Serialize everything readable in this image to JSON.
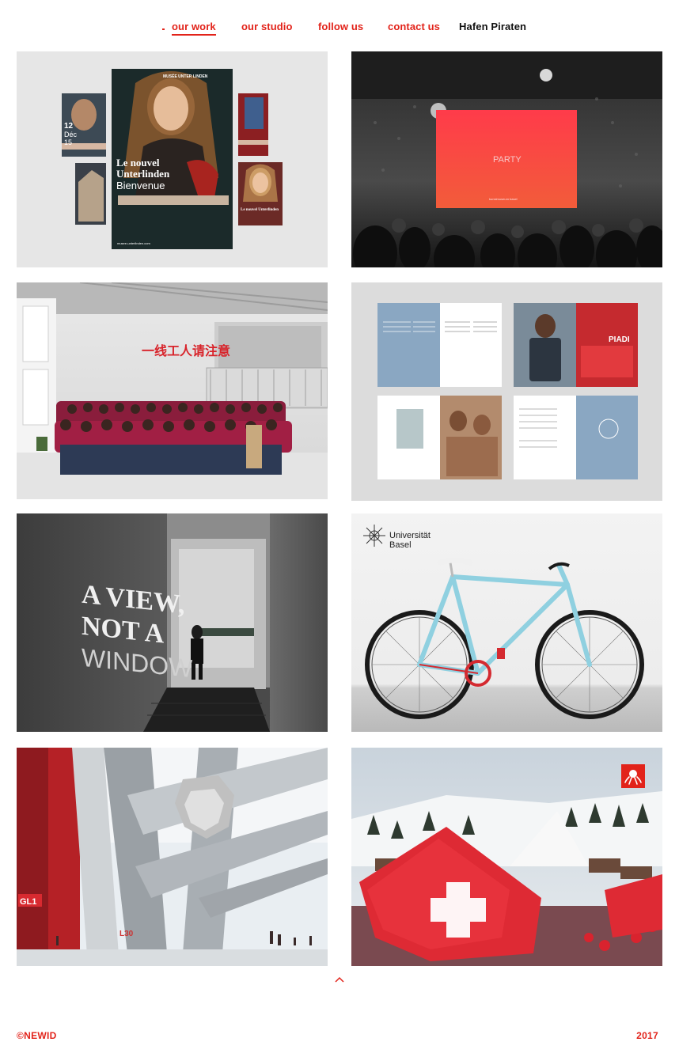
{
  "nav": {
    "items": [
      {
        "label": "our work",
        "active": true
      },
      {
        "label": "our studio",
        "active": false
      },
      {
        "label": "follow us",
        "active": false
      },
      {
        "label": "contact us",
        "active": false
      }
    ],
    "brand": "Hafen Piraten"
  },
  "tiles": {
    "poster": {
      "museum_name": "MUSÉE UNTER LINDEN",
      "headline_1": "Le nouvel",
      "headline_2": "Unterlinden",
      "subline": "Bienvenue",
      "url": "musee-unterlinden.com",
      "small_date_1": "12",
      "small_date_2": "Déc",
      "small_date_3": "15",
      "small_headline": "Le nouvel Unterlinden"
    },
    "party": {
      "screen_text": "PARTY",
      "screen_subtext": "kunstmuseum basel"
    },
    "factory": {
      "banner_text": "一线工人请注意"
    },
    "magazine": {
      "ad_text": "PIADI"
    },
    "view": {
      "wall_line_1": "A VIEW,",
      "wall_line_2": "NOT A",
      "wall_line_3": "WINDOW"
    },
    "bike": {
      "logo_line_1": "Universität",
      "logo_line_2": "Basel"
    },
    "stadium": {
      "sign_1": "GL1",
      "sign_2": "L30"
    },
    "ski": {}
  },
  "footer": {
    "copyright": "©NEWID",
    "year": "2017"
  },
  "colors": {
    "accent": "#e2231a",
    "text": "#111111",
    "background": "#ffffff"
  },
  "icons": {
    "scroll_top": "chevron-up-icon",
    "ski_badge": "octopus-logo-icon"
  }
}
